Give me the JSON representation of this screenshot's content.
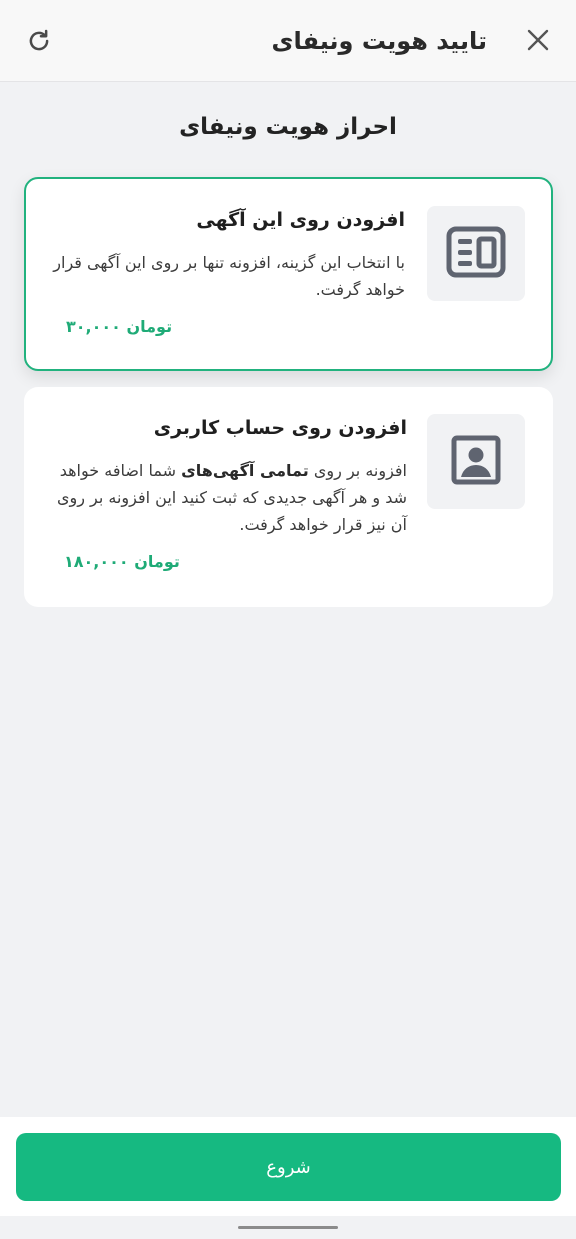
{
  "header": {
    "title": "تایید هویت ونیفای",
    "close_icon": "close-icon",
    "refresh_icon": "refresh-icon"
  },
  "section_heading": "احراز هویت ونیفای",
  "options": [
    {
      "title": "افزودن روی این آگهی",
      "description": "با انتخاب این گزینه، افزونه تنها بر روی این آگهی قرار خواهد گرفت.",
      "price_value": "۳۰,۰۰۰",
      "price_unit": "تومان",
      "icon": "newspaper-icon",
      "selected": true
    },
    {
      "title": "افزودن روی حساب کاربری",
      "description_before": "افزونه بر روی ",
      "description_bold": "تمامی آگهی‌های",
      "description_after": " شما اضافه خواهد شد و هر آگهی جدیدی که ثبت کنید این افزونه بر روی آن نیز قرار خواهد گرفت.",
      "price_value": "۱۸۰,۰۰۰",
      "price_unit": "تومان",
      "icon": "account-portrait-icon",
      "selected": false
    }
  ],
  "start_button": "شروع",
  "colors": {
    "accent": "#16b981",
    "price": "#1fab77",
    "selected_border": "#21b27e",
    "background": "#f1f2f4"
  }
}
